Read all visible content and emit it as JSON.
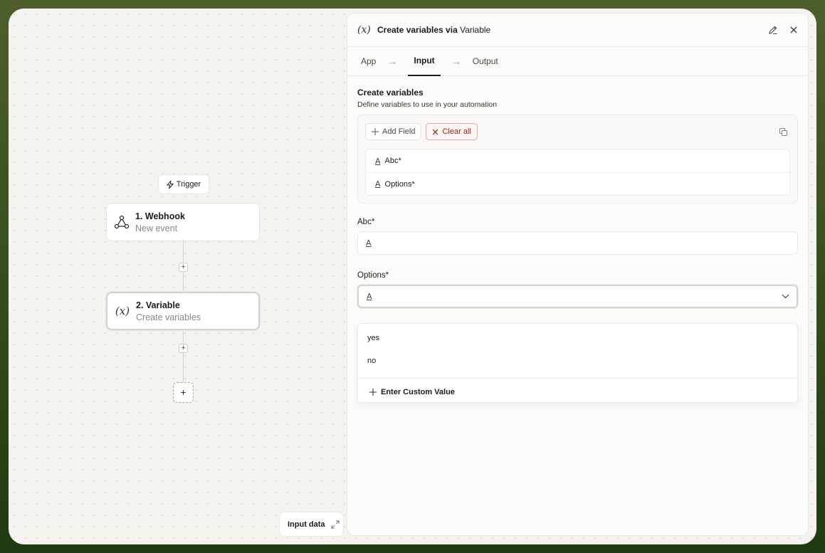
{
  "canvas": {
    "trigger_label": "Trigger",
    "nodes": [
      {
        "title": "1. Webhook",
        "subtitle": "New event",
        "icon": "webhook-icon"
      },
      {
        "title": "2. Variable",
        "subtitle": "Create variables",
        "icon": "variable-icon",
        "icon_glyph": "(x)"
      }
    ],
    "add_step": "+",
    "input_data_label": "Input data"
  },
  "panel": {
    "icon_glyph": "(x)",
    "title": "Create variables via",
    "app_name": "Variable",
    "tabs": [
      "App",
      "Input",
      "Output"
    ],
    "active_tab": "Input",
    "section_title": "Create variables",
    "section_subtitle": "Define variables to use in your automation",
    "add_field_label": "Add Field",
    "clear_all_label": "Clear all",
    "fields": [
      {
        "name": "Abc*",
        "type_icon": "A"
      },
      {
        "name": "Options*",
        "type_icon": "A"
      }
    ],
    "abc_label": "Abc*",
    "abc_value": "",
    "options_label": "Options*",
    "options_value": "",
    "dropdown_options": [
      "yes",
      "no"
    ],
    "custom_value_label": "Enter Custom Value"
  },
  "colors": {
    "accent_clear": "#8b1f18",
    "frame_bg": "#4e5f2c"
  }
}
